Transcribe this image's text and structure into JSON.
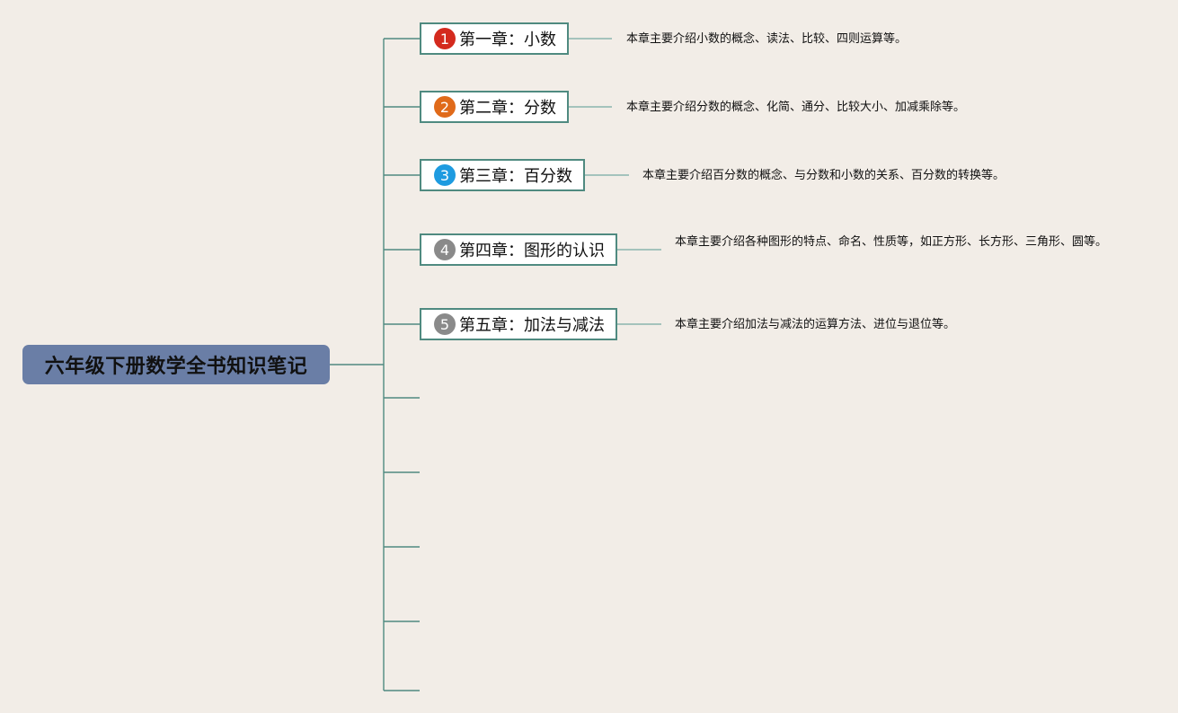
{
  "root": {
    "title": "六年级下册数学全书知识笔记"
  },
  "chapters": [
    {
      "num": "1",
      "title": "第一章：小数",
      "badge_color": "#d42a1e",
      "desc": "本章主要介绍小数的概念、读法、比较、四则运算等。"
    },
    {
      "num": "2",
      "title": "第二章：分数",
      "badge_color": "#e06a1a",
      "desc": "本章主要介绍分数的概念、化简、通分、比较大小、加减乘除等。"
    },
    {
      "num": "3",
      "title": "第三章：百分数",
      "badge_color": "#1e9be0",
      "desc": "本章主要介绍百分数的概念、与分数和小数的关系、百分数的转换等。"
    },
    {
      "num": "4",
      "title": "第四章：图形的认识",
      "badge_color": "#8a8a8a",
      "desc": "本章主要介绍各种图形的特点、命名、性质等，如正方形、长方形、三角形、圆等。"
    },
    {
      "num": "5",
      "title": "第五章：加法与减法",
      "badge_color": "#8a8a8a",
      "desc": "本章主要介绍加法与减法的运算方法、进位与退位等。"
    }
  ],
  "colors": {
    "line": "#4f8a80",
    "root_bg": "#6a7ea6",
    "background": "#f2ede7"
  }
}
